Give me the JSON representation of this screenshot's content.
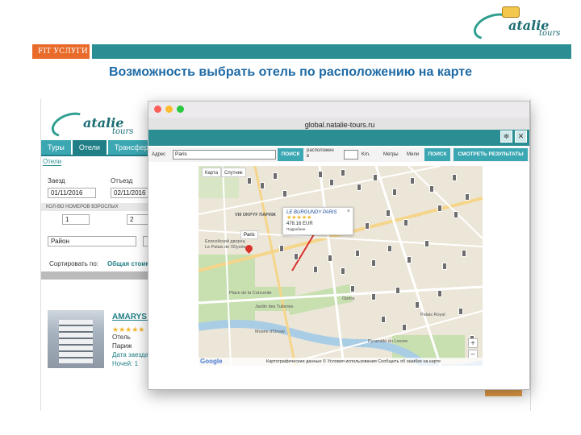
{
  "slide": {
    "section_label": "FIT УСЛУГИ",
    "title": "Возможность выбрать отель по расположению на карте",
    "logo_text": "atalie",
    "logo_sub": "tours",
    "colors": {
      "orange": "#e86b2a",
      "teal": "#2a8e92",
      "title_blue": "#1f6ba6"
    }
  },
  "site": {
    "tabs": [
      {
        "label": "Туры"
      },
      {
        "label": "Отели"
      },
      {
        "label": "Трансфер"
      }
    ],
    "sub_tab": "Отели",
    "checkin_label": "Заезд",
    "checkin_value": "01/11/2016",
    "checkout_label": "Отъезд",
    "checkout_value": "02/11/2016",
    "rooms_band": "КОЛ-ВО НОМЕРОВ       ВЗРОСЛЫХ",
    "rooms_value": "1",
    "adults_value": "2",
    "district_placeholder": "Район",
    "sort_label": "Сортировать по:",
    "sort_value": "Общая стоим",
    "hotel_name": "AMARYS S",
    "hotel_type": "Отель",
    "hotel_city": "Париж",
    "hotel_date_label": "Дата заезда",
    "hotel_nights": "Ночей: 1"
  },
  "window": {
    "url": "global.natalie-tours.ru",
    "search": {
      "address_label": "Адрес",
      "address_value": "Paris",
      "search_button": "ПОИСК",
      "radius_label": "расположен в",
      "km_label": "Km.",
      "meters_label": "Метры",
      "miles_label": "Мили",
      "search_button_2": "ПОИСК",
      "show_results_button": "СМОТРЕТЬ РЕЗУЛЬТАТЫ"
    },
    "map": {
      "tab_map": "Карта",
      "tab_satellite": "Спутник",
      "search_tag": "Paris",
      "popup_name": "LE BURGUNDY PARIS",
      "popup_stars": "★★★★★",
      "popup_price": "478.16 EUR",
      "popup_link": "Подробнее",
      "footer": "Картографические данные ©  Условия использования     Сообщить об ошибке на карте",
      "google": "Google",
      "labels": [
        "Еписейский дворец",
        "Le Palais de l'Élysée",
        "Place de la Concorde",
        "Jardin des Tuileries",
        "Musée d'Orsay",
        "Palais Royal",
        "Pyramide du Louvre",
        "Opéra",
        "VIII OKPYF ПАРИЖ"
      ]
    }
  }
}
